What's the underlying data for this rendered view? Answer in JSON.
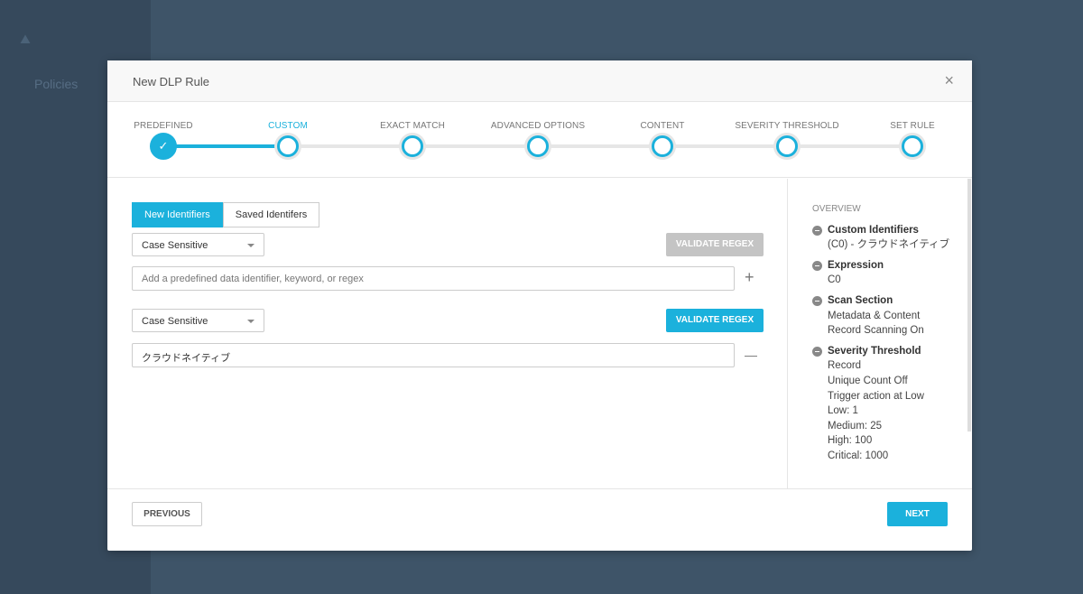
{
  "background": {
    "nav_item": "Policies"
  },
  "modal": {
    "title": "New DLP Rule",
    "close": "×"
  },
  "steps": [
    {
      "label": "PREDEFINED",
      "state": "done"
    },
    {
      "label": "CUSTOM",
      "state": "active"
    },
    {
      "label": "EXACT MATCH"
    },
    {
      "label": "ADVANCED OPTIONS"
    },
    {
      "label": "CONTENT"
    },
    {
      "label": "SEVERITY THRESHOLD"
    },
    {
      "label": "SET RULE"
    }
  ],
  "check": "✓",
  "tabs": {
    "new": "New Identifiers",
    "saved": "Saved Identifers"
  },
  "rows": [
    {
      "select": "Case Sensitive",
      "validate": "VALIDATE REGEX",
      "input_placeholder": "Add a predefined data identifier, keyword, or regex",
      "action": "+"
    },
    {
      "select": "Case Sensitive",
      "validate": "VALIDATE REGEX",
      "input_value": "クラウドネイティブ",
      "action": "—"
    }
  ],
  "overview": {
    "title": "OVERVIEW",
    "sections": [
      {
        "heading": "Custom Identifiers",
        "lines": [
          "(C0) - クラウドネイティブ"
        ]
      },
      {
        "heading": "Expression",
        "lines": [
          "C0"
        ]
      },
      {
        "heading": "Scan Section",
        "lines": [
          "Metadata & Content",
          "Record Scanning On"
        ]
      },
      {
        "heading": "Severity Threshold",
        "lines": [
          "Record",
          "Unique Count Off",
          "Trigger action at Low",
          "Low: 1",
          "Medium: 25",
          "High: 100",
          "Critical: 1000"
        ]
      }
    ]
  },
  "footer": {
    "previous": "PREVIOUS",
    "next": "NEXT"
  },
  "colors": {
    "accent": "#1bb1dc",
    "disabled": "#c4c4c4"
  }
}
